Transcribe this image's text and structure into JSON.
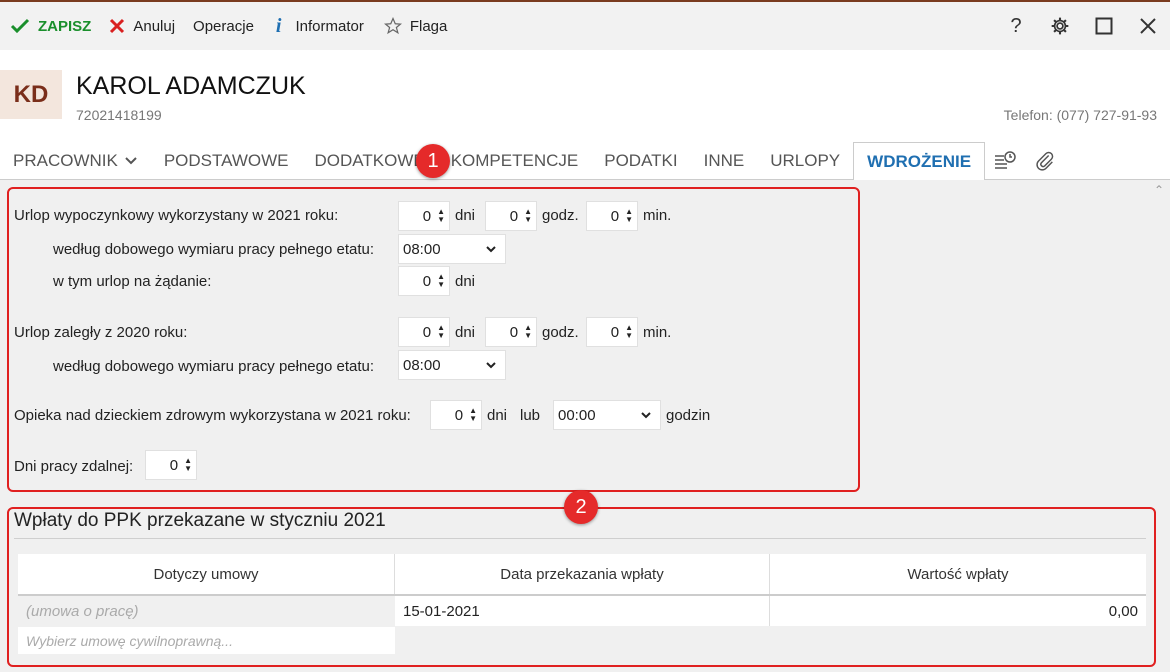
{
  "toolbar": {
    "save": "ZAPISZ",
    "cancel": "Anuluj",
    "operations": "Operacje",
    "informator": "Informator",
    "flag": "Flaga"
  },
  "employee": {
    "initials": "KD",
    "name": "KAROL ADAMCZUK",
    "id_number": "72021418199",
    "phone": "Telefon: (077) 727-91-93"
  },
  "tabs": [
    {
      "label": "PRACOWNIK"
    },
    {
      "label": "PODSTAWOWE"
    },
    {
      "label": "DODATKOWE"
    },
    {
      "label": "KOMPETENCJE"
    },
    {
      "label": "PODATKI"
    },
    {
      "label": "INNE"
    },
    {
      "label": "URLOPY"
    },
    {
      "label": "WDROŻENIE"
    }
  ],
  "form": {
    "vacation_used_label": "Urlop wypoczynkowy wykorzystany w 2021 roku:",
    "vacation_days": "0",
    "vacation_hours": "0",
    "vacation_minutes": "0",
    "daily_norm_label": "według dobowego wymiaru pracy pełnego etatu:",
    "daily_norm_value": "08:00",
    "on_demand_label": "w tym urlop na żądanie:",
    "on_demand_days": "0",
    "overdue_label": "Urlop zaległy z 2020 roku:",
    "overdue_days": "0",
    "overdue_hours": "0",
    "overdue_minutes": "0",
    "daily_norm_label_2": "według dobowego wymiaru pracy pełnego etatu:",
    "daily_norm_value_2": "08:00",
    "childcare_label": "Opieka nad dzieckiem zdrowym wykorzystana w 2021 roku:",
    "childcare_days": "0",
    "childcare_or": "lub",
    "childcare_hours": "00:00",
    "childcare_hours_unit": "godzin",
    "remote_label": "Dni pracy zdalnej:",
    "remote_days": "0",
    "unit_days": "dni",
    "unit_hours": "godz.",
    "unit_minutes": "min."
  },
  "ppk": {
    "title": "Wpłaty do PPK przekazane w styczniu 2021",
    "columns": [
      "Dotyczy umowy",
      "Data przekazania wpłaty",
      "Wartość wpłaty"
    ],
    "rows": [
      {
        "contract": "(umowa o pracę)",
        "date": "15-01-2021",
        "value": "0,00"
      }
    ],
    "picker_placeholder": "Wybierz umowę cywilnoprawną..."
  },
  "annotations": [
    "1",
    "2"
  ]
}
